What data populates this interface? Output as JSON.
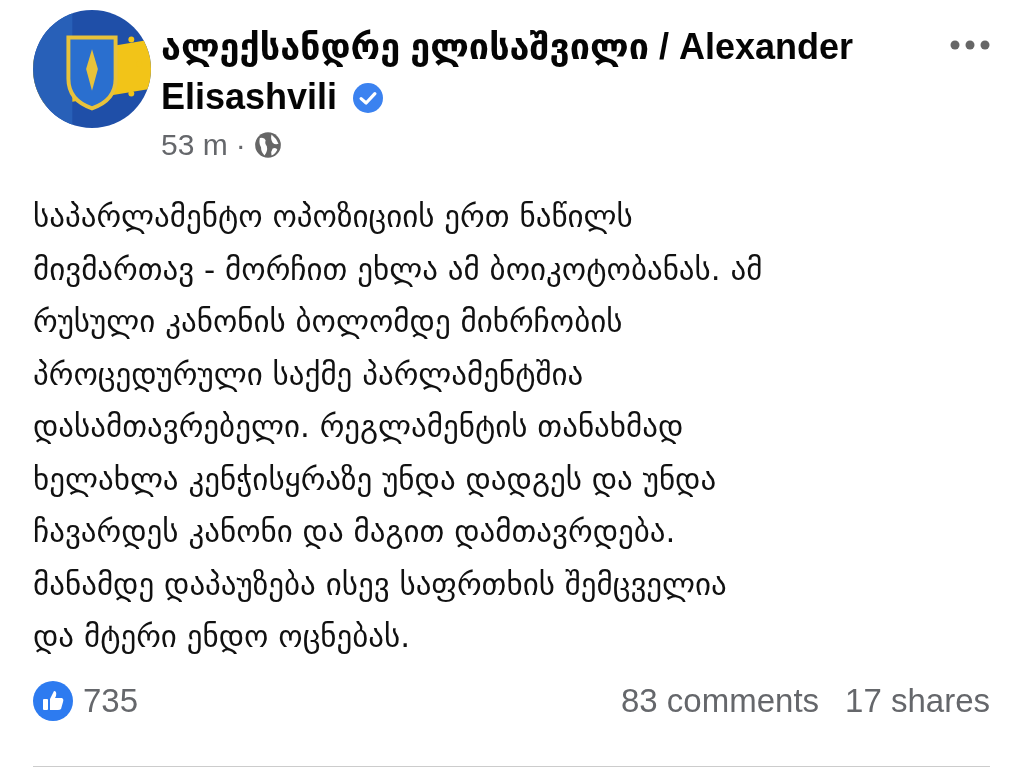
{
  "post": {
    "author": {
      "name": "ალექსანდრე ელისაშვილი / Alexander Elisashvili",
      "verified": true
    },
    "time": "53 m",
    "separator": "·",
    "text_lines": [
      "საპარლამენტო ოპოზიციის ერთ ნაწილს",
      "მივმართავ - მორჩით ეხლა ამ ბოიკოტობანას. ამ",
      "რუსული კანონის ბოლომდე მიხრჩობის",
      "პროცედურული საქმე პარლამენტშია",
      "დასამთავრებელი. რეგლამენტის თანახმად",
      "ხელახლა კენჭისყრაზე უნდა დადგეს და უნდა",
      "ჩავარდეს კანონი და მაგით დამთავრდება.",
      "მანამდე დაპაუზება ისევ საფრთხის შემცველია",
      "და მტერი ენდო ოცნებას."
    ],
    "likes": "735",
    "comments": "83 comments",
    "shares": "17 shares"
  }
}
